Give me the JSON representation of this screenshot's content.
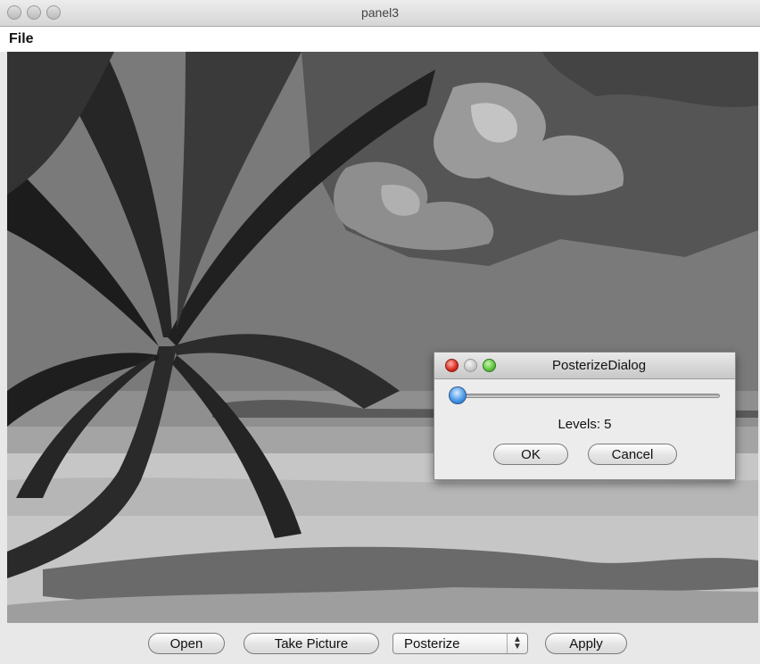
{
  "window": {
    "title": "panel3"
  },
  "menubar": {
    "file_label": "File"
  },
  "toolbar": {
    "open_label": "Open",
    "take_picture_label": "Take Picture",
    "filter_select_value": "Posterize",
    "apply_label": "Apply"
  },
  "dialog": {
    "title": "PosterizeDialog",
    "levels_label": "Levels: 5",
    "ok_label": "OK",
    "cancel_label": "Cancel",
    "slider_value": 0.0
  },
  "icons": {
    "close": "close-icon",
    "minimize": "minimize-icon",
    "zoom": "zoom-icon",
    "select_arrows": "up-down-arrows-icon"
  }
}
